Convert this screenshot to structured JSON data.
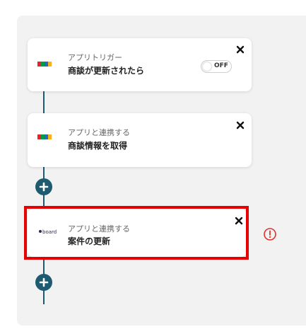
{
  "flow": {
    "step1": {
      "app_icon": "zoho-crm-logo-icon",
      "subtitle": "アプリトリガー",
      "title": "商談が更新されたら",
      "toggle_state": "OFF",
      "close_icon": "close-icon"
    },
    "step2": {
      "app_icon": "zoho-crm-logo-icon",
      "subtitle": "アプリと連携する",
      "title": "商談情報を取得",
      "close_icon": "close-icon"
    },
    "step3": {
      "app_icon": "board-logo-icon",
      "subtitle": "アプリと連携する",
      "title": "案件の更新",
      "close_icon": "close-icon",
      "warning_icon": "warning-circle-icon"
    },
    "add_icon": "plus-icon"
  },
  "colors": {
    "canvas_bg": "#f2f2f2",
    "connector": "#1e5a70",
    "highlight": "#e60000",
    "warning": "#e0302a"
  }
}
